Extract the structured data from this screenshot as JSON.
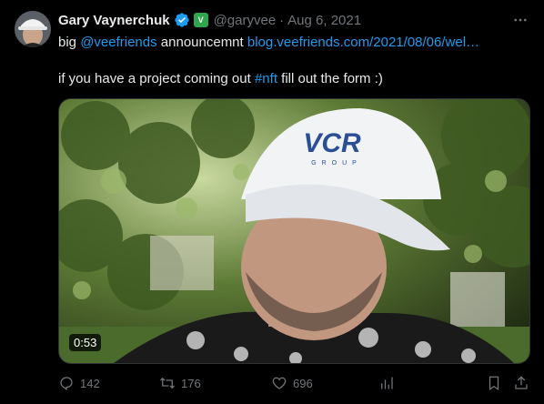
{
  "tweet": {
    "author_name": "Gary Vaynerchuk",
    "affiliate_badge_text": "V",
    "handle": "@garyvee",
    "separator": "·",
    "date": "Aug 6, 2021",
    "text": {
      "line1_prefix": "big ",
      "mention": "@veefriends",
      "line1_mid": " announcemnt ",
      "url": "blog.veefriends.com/2021/08/06/wel…",
      "line2_prefix": "if you have a project coming out ",
      "hashtag": "#nft",
      "line2_suffix": " fill out the form :)"
    },
    "media": {
      "duration": "0:53",
      "cap_logo": "VCR",
      "cap_sub": "GROUP"
    },
    "metrics": {
      "replies": "142",
      "reposts": "176",
      "likes": "696"
    }
  },
  "icons": [
    "verified-icon",
    "more-icon",
    "reply-icon",
    "repost-icon",
    "like-icon",
    "views-icon",
    "bookmark-icon",
    "share-icon"
  ],
  "colors": {
    "background": "#000000",
    "text": "#e7e9ea",
    "muted": "#71767b",
    "link": "#1d9bf0",
    "verified": "#1d9bf0"
  }
}
